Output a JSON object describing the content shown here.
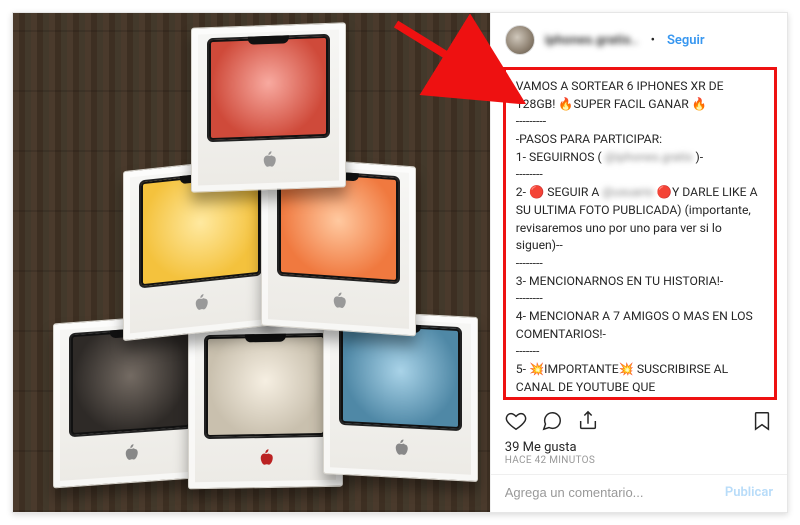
{
  "header": {
    "username": "iphones.gratis..",
    "follow_label": "Seguir",
    "separator": "•"
  },
  "caption": {
    "line1": "VAMOS A SORTEAR 6 IPHONES XR DE 128GB! 🔥SUPER FACIL GANAR 🔥",
    "sep1": "---------",
    "line2": "-PASOS PARA PARTICIPAR:",
    "line3a": "1- SEGUIRNOS ( ",
    "line3_blur": "@iphones.gratis",
    "line3b": " )-",
    "sep2": "--------",
    "line4a": "2- 🔴 SEGUIR A ",
    "line4_blur": "@usuario",
    "line4b": " 🔴Y DARLE LIKE A SU ULTIMA FOTO PUBLICADA) (importante, revisaremos uno por uno para ver si lo siguen)--",
    "sep3": "--------",
    "line5": "3- MENCIONARNOS EN TU HISTORIA!-",
    "sep4": "--------",
    "line6": "4- MENCIONAR A 7 AMIGOS O MAS EN LOS COMENTARIOS!-",
    "sep5": "-------",
    "line7": "5- 💥IMPORTANTE💥 SUSCRIBIRSE AL CANAL DE YOUTUBE QUE"
  },
  "engagement": {
    "likes_text": "39 Me gusta",
    "time_text": "Hace 42 minutos"
  },
  "comment": {
    "placeholder": "Agrega un comentario...",
    "publish_label": "Publicar"
  },
  "colors": {
    "highlight_border": "#e11",
    "link_blue": "#3897f0"
  },
  "image": {
    "description": "Six sealed iPhone XR retail boxes stacked in a pyramid on a dark wood surface",
    "box_colors": [
      "black",
      "white",
      "blue",
      "yellow",
      "coral",
      "red"
    ]
  }
}
